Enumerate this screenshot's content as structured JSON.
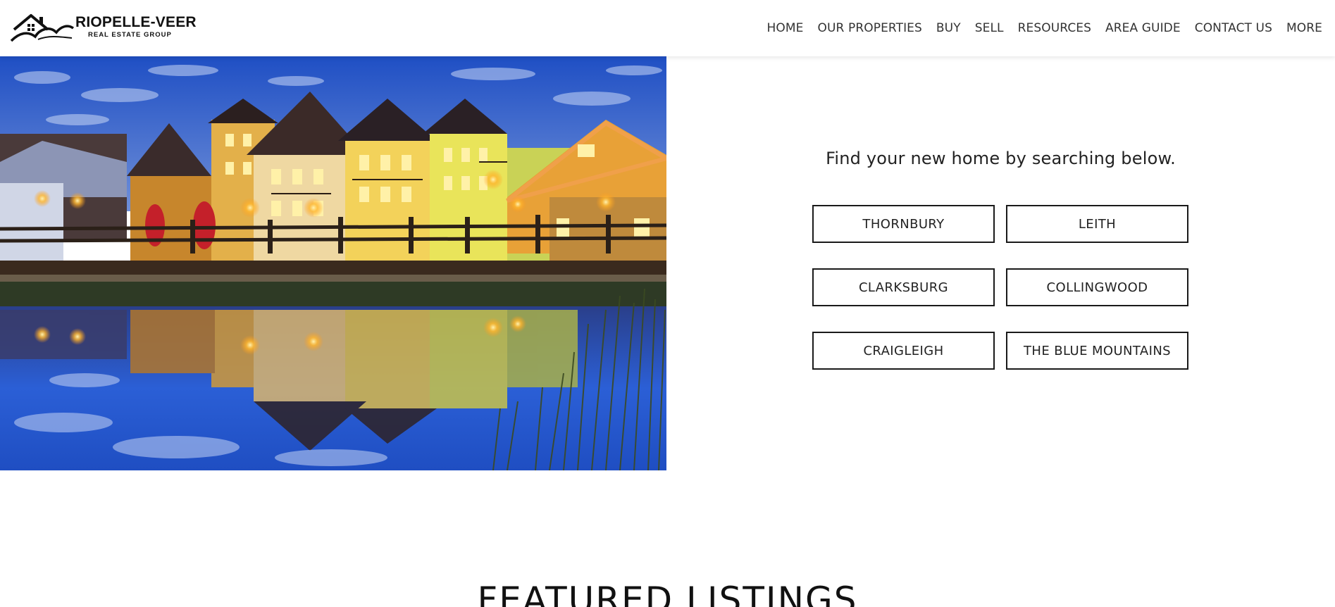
{
  "brand": {
    "name": "RIOPELLE-VEER",
    "tagline": "REAL ESTATE GROUP"
  },
  "nav": {
    "items": [
      "HOME",
      "OUR PROPERTIES",
      "BUY",
      "SELL",
      "RESOURCES",
      "AREA GUIDE",
      "CONTACT US",
      "MORE"
    ]
  },
  "search": {
    "heading": "Find your new home by searching below.",
    "areas": [
      "THORNBURY",
      "LEITH",
      "CLARKSBURG",
      "COLLINGWOOD",
      "CRAIGLEIGH",
      "THE BLUE MOUNTAINS"
    ]
  },
  "featured": {
    "title": "FEATURED LISTINGS"
  },
  "colors": {
    "button_border": "#1a1a1a",
    "text": "#222222",
    "sky": "#2a5bd0",
    "lights": "#ffb62e"
  }
}
